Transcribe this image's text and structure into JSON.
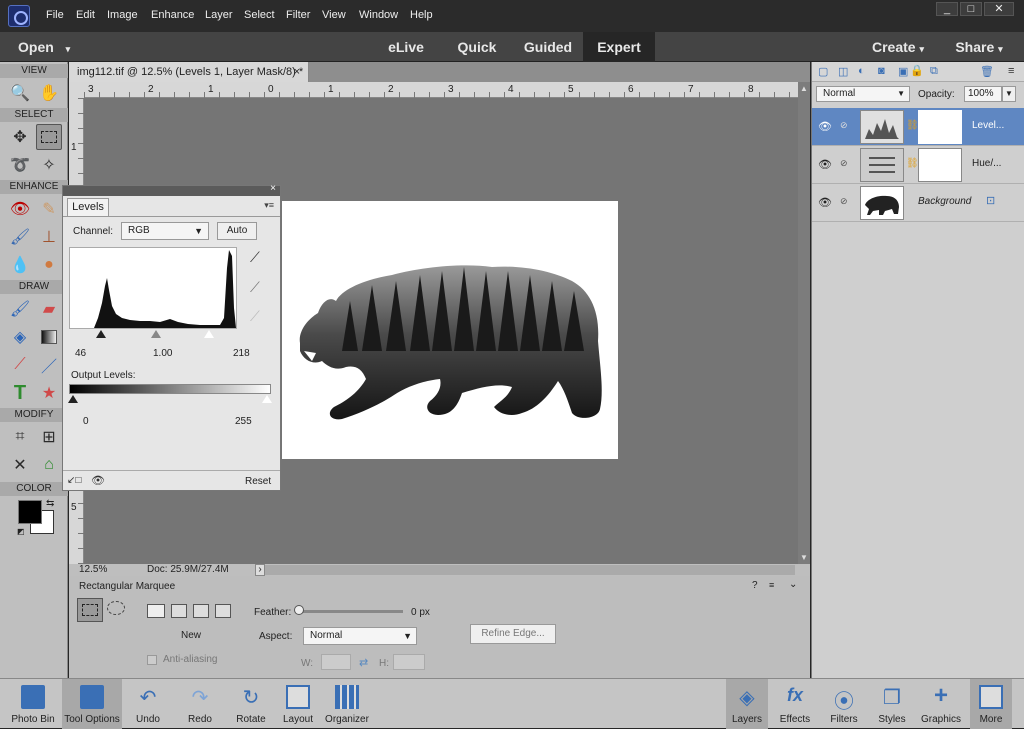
{
  "menu": [
    "File",
    "Edit",
    "Image",
    "Enhance",
    "Layer",
    "Select",
    "Filter",
    "View",
    "Window",
    "Help"
  ],
  "window_controls": [
    "_",
    "□",
    "✕"
  ],
  "mode": {
    "open": "Open",
    "tabs": [
      "eLive",
      "Quick",
      "Guided",
      "Expert"
    ],
    "active_tab": "Expert",
    "create": "Create",
    "share": "Share"
  },
  "tools": {
    "sections": [
      "VIEW",
      "SELECT",
      "ENHANCE",
      "DRAW",
      "MODIFY",
      "COLOR"
    ]
  },
  "document": {
    "tab_title": "img112.tif @ 12.5% (Levels 1, Layer Mask/8) *",
    "zoom": "12.5%",
    "doc_size": "Doc: 25.9M/27.4M",
    "hruler": [
      "3",
      "2",
      "1",
      "0",
      "1",
      "2",
      "3",
      "4",
      "5",
      "6",
      "7",
      "8"
    ],
    "vruler": [
      "1",
      "5"
    ]
  },
  "levels": {
    "tab": "Levels",
    "channel_label": "Channel:",
    "channel_value": "RGB",
    "auto": "Auto",
    "input_black": "46",
    "input_gamma": "1.00",
    "input_white": "218",
    "output_label": "Output Levels:",
    "output_black": "0",
    "output_white": "255",
    "reset": "Reset"
  },
  "tool_options": {
    "tool_name": "Rectangular Marquee",
    "new_label": "New",
    "antialias": "Anti-aliasing",
    "feather_label": "Feather:",
    "feather_value": "0 px",
    "aspect_label": "Aspect:",
    "aspect_value": "Normal",
    "w_label": "W:",
    "h_label": "H:",
    "refine": "Refine Edge..."
  },
  "layers": {
    "blend_mode": "Normal",
    "opacity_label": "Opacity:",
    "opacity_value": "100%",
    "items": [
      {
        "name": "Level..."
      },
      {
        "name": "Hue/..."
      },
      {
        "name": "Background"
      }
    ]
  },
  "bottom_left": [
    "Photo Bin",
    "Tool Options",
    "Undo",
    "Redo",
    "Rotate",
    "Layout",
    "Organizer"
  ],
  "bottom_right": [
    "Layers",
    "Effects",
    "Filters",
    "Styles",
    "Graphics",
    "More"
  ]
}
